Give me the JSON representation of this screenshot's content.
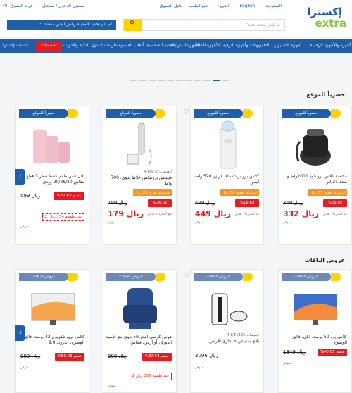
{
  "header": {
    "logo_top": "إكسترا",
    "logo_bottom": "extra",
    "language": "English",
    "country": "السعودية",
    "branches": "الفروع",
    "track_order": "تتبع الطلب",
    "guide": "دليل التسوق",
    "login": "تسجيل الدخول / تسجيل",
    "cart": "عربة التسوق (0)",
    "search_placeholder": "ما الذي تبحث عنه؟",
    "location": "لم يتم تحديد المدينة   رياض الخبر مستحدث"
  },
  "nav": {
    "items": [
      "أجهزة والأجهزة الرقمية",
      "أجهزة الكمبيوتر",
      "التلفزيونات وأجهزة الترفيه",
      "الأجهزة الذكية",
      "الأجهزة المنزلية",
      "الأجهزة الصغيرة",
      "العناية الشخصية",
      "ألعاب الفيديو",
      "مستلزمات المنزل",
      "أجهزة المنزل الذكية والأدوات",
      "تخفيضات"
    ],
    "offers": "خدمات إكسترا",
    "sale_button": "تخفيضات"
  },
  "sections": [
    {
      "title": "حصرياً للموقع"
    },
    {
      "title": "عروض الباقات"
    }
  ],
  "row1": [
    {
      "badge": "حصرياً للموقع",
      "title": "مكنسة كلاس برو قوة 2000واط و سعة 21 لتر",
      "orange": "استرداد نقدي 37 ريال",
      "old": "369 ريال",
      "disc": "%26.03 خصم",
      "big": "332 ريال",
      "small": "مع استرداد نقدي",
      "avail": "متوفر"
    },
    {
      "badge": "حصرياً للموقع",
      "title": "كلاس برو برادة ماء، فريزر 520 واط، أبيض",
      "orange": "استرداد نقدي 50 ريال",
      "old": "499 ريال",
      "disc": "%16.69 خصم",
      "big": "449 ريال",
      "small": "مع استرداد نقدي",
      "avail": "متوفر"
    },
    {
      "badge": "حصرياً للموقع",
      "title": "فيليبس بروتيكس خلاط يدوي، 700 واط",
      "rating": "4.6/5 (7 تقييمات)",
      "orange": "استرداد نقدي 20 ريال",
      "old": "199 ريال",
      "disc": "%26.02 خصم",
      "big": "179 ريال",
      "small": "مع استرداد نقدي",
      "avail": "متوفر"
    },
    {
      "badge": "حصرياً للموقع",
      "title": "تاتل تنس طقم شنط سفر 3 قطع مقاس 20/26/30 وردي",
      "old": "599 ريال",
      "disc": "%31.63 خصم",
      "coupon": "2 عدد طقمة 154 ريال",
      "avail": "متوفر"
    }
  ],
  "row2": [
    {
      "badge": "عروض الباقات",
      "title": "كلاس برو 50 بوصة، ذكي، فائق الوضوح",
      "old": "1349 ريال",
      "disc": "%46.01 خصم",
      "avail": "متوفر"
    },
    {
      "badge": "عروض الباقات",
      "title": "بلاي ستيشن 5، قارئ أقراص",
      "rating": "4.8/5 (105 تقييمات)",
      "price": "3096 ريال",
      "avail": "متوفر"
    },
    {
      "badge": "عروض الباقات",
      "title": "هوس كرسي استرخاء يدوي مع خاصية الدوران أو أرفق، قماش",
      "old": "999 ريال",
      "disc": "%37.52 خصم",
      "coupon": "2 عدد طقمة 307 ريال",
      "avail": "متوفر"
    },
    {
      "badge": "عروض الباقات",
      "title": "كلاس برو، تلفزيون 42 بوصة، فائق الوضوح، أندرويد 9.0",
      "old": "999 ريال",
      "disc": "%50.02 خصم",
      "avail": "متوفر"
    }
  ],
  "colors": {
    "brand": "#1f5ea8",
    "accent": "#ffd200",
    "sale": "#e31b23",
    "cashback": "#f7931e"
  }
}
